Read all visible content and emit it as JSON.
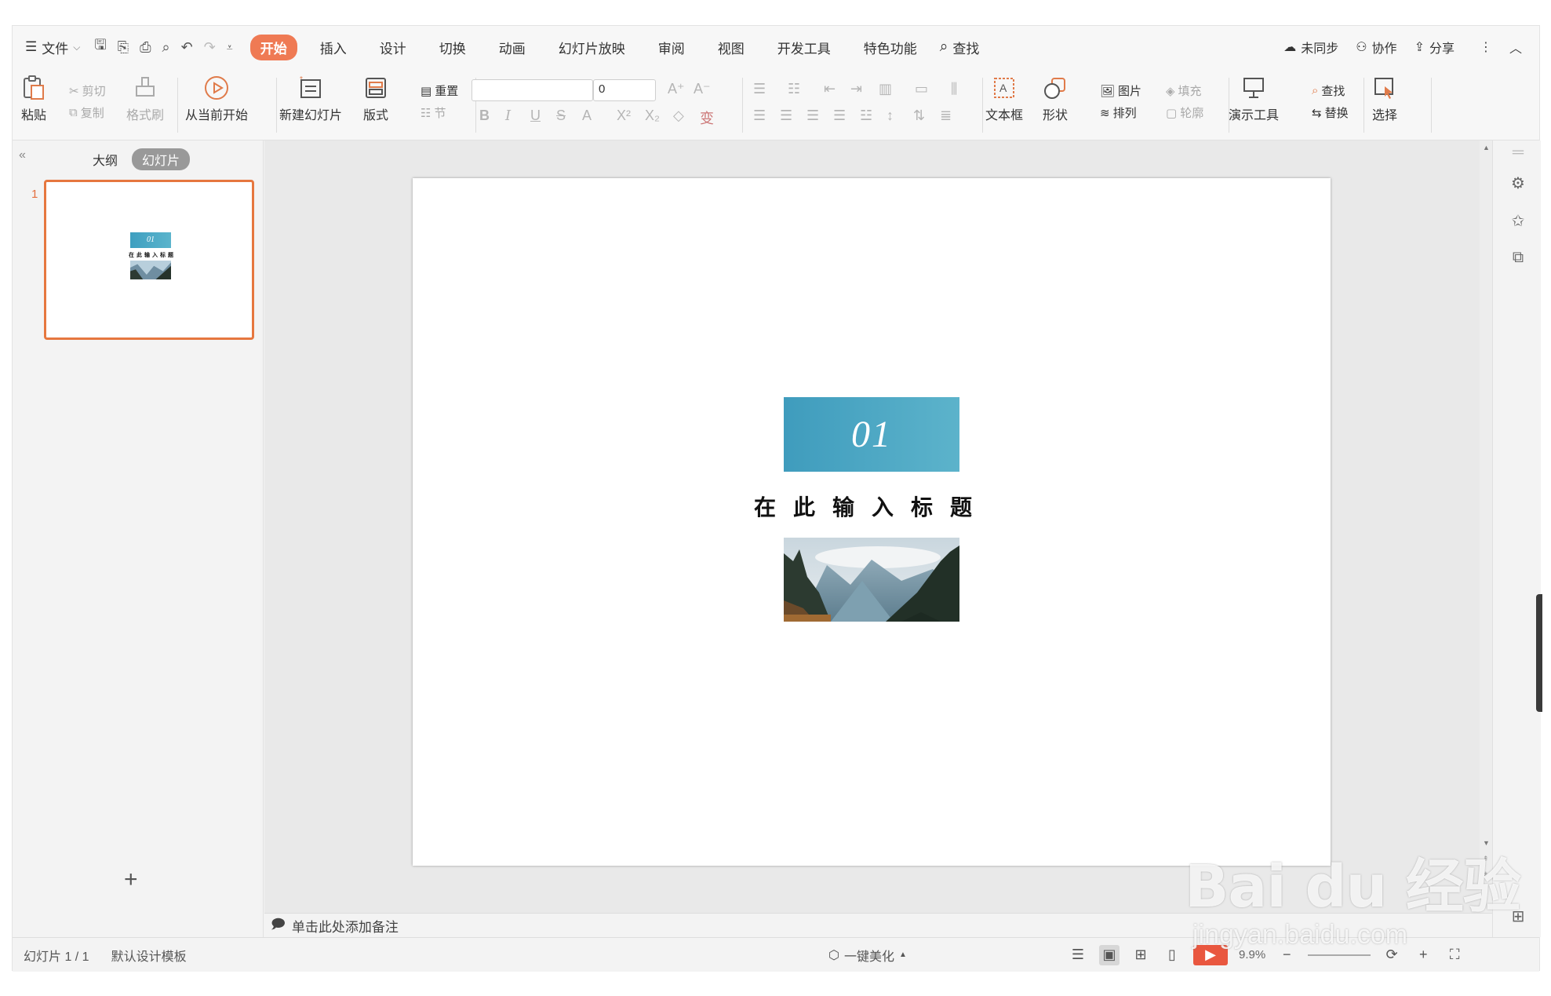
{
  "menu": {
    "file_label": "文件",
    "tabs": [
      "开始",
      "插入",
      "设计",
      "切换",
      "动画",
      "幻灯片放映",
      "审阅",
      "视图",
      "开发工具",
      "特色功能"
    ],
    "search_label": "查找",
    "sync_label": "未同步",
    "collab_label": "协作",
    "share_label": "分享"
  },
  "ribbon": {
    "paste": "粘贴",
    "cut": "剪切",
    "copy": "复制",
    "format_painter": "格式刷",
    "from_current": "从当前开始",
    "new_slide": "新建幻灯片",
    "layout": "版式",
    "reset": "重置",
    "section": "节",
    "font_size_value": "0",
    "textbox": "文本框",
    "shape": "形状",
    "picture": "图片",
    "fill": "填充",
    "arrange": "排列",
    "outline": "轮廓",
    "presenter_tools": "演示工具",
    "find": "查找",
    "replace": "替换",
    "select": "选择"
  },
  "panel": {
    "outline_tab": "大纲",
    "slides_tab": "幻灯片",
    "slide_number": "1"
  },
  "slide": {
    "number_text": "01",
    "title_text": "在此输入标题"
  },
  "notes": {
    "placeholder": "单击此处添加备注"
  },
  "status": {
    "slide_count": "幻灯片 1 / 1",
    "template": "默认设计模板",
    "beautify": "一键美化",
    "zoom": "9.9%"
  },
  "watermark": {
    "brand": "Bai du 经验",
    "url": "jingyan.baidu.com"
  },
  "colors": {
    "accent": "#ef7a54",
    "thumb_border": "#e6773f",
    "number_box": "#4aa8c5"
  }
}
